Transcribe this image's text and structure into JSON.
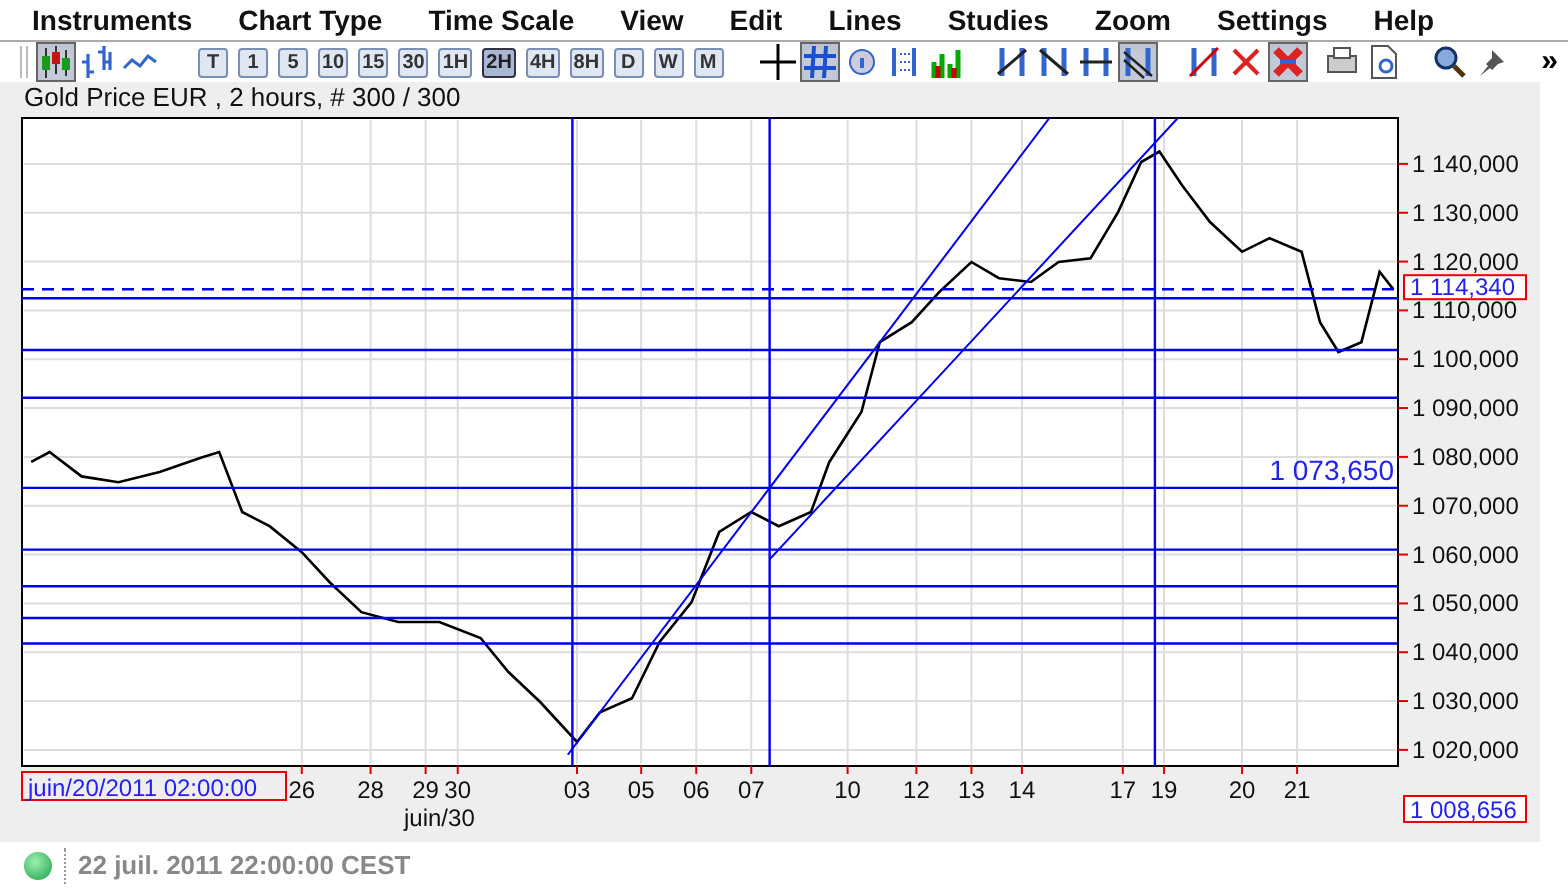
{
  "menu": [
    "Instruments",
    "Chart Type",
    "Time Scale",
    "View",
    "Edit",
    "Lines",
    "Studies",
    "Zoom",
    "Settings",
    "Help"
  ],
  "toolbar": {
    "chart_types": [
      {
        "kind": "candles",
        "selected": true
      },
      {
        "kind": "bars",
        "selected": false
      },
      {
        "kind": "line",
        "selected": false
      }
    ],
    "timeframes": [
      {
        "label": "T",
        "selected": false
      },
      {
        "label": "1",
        "selected": false
      },
      {
        "label": "5",
        "selected": false
      },
      {
        "label": "10",
        "selected": false
      },
      {
        "label": "15",
        "selected": false
      },
      {
        "label": "30",
        "selected": false
      },
      {
        "label": "1H",
        "selected": false
      },
      {
        "label": "2H",
        "selected": true
      },
      {
        "label": "4H",
        "selected": false
      },
      {
        "label": "8H",
        "selected": false
      },
      {
        "label": "D",
        "selected": false
      },
      {
        "label": "W",
        "selected": false
      },
      {
        "label": "M",
        "selected": false
      }
    ],
    "tools": [
      {
        "kind": "crosshair",
        "selected": false
      },
      {
        "kind": "grid",
        "selected": true
      },
      {
        "kind": "info",
        "selected": false
      },
      {
        "kind": "dots",
        "selected": false
      },
      {
        "kind": "volume",
        "selected": false
      },
      {
        "kind": "trend",
        "selected": false
      },
      {
        "kind": "fall",
        "selected": false
      },
      {
        "kind": "flat",
        "selected": false
      },
      {
        "kind": "channel",
        "selected": true
      },
      {
        "kind": "erase-line",
        "selected": false
      },
      {
        "kind": "delete",
        "selected": false
      },
      {
        "kind": "delete-all",
        "selected": true
      },
      {
        "kind": "print",
        "selected": false
      },
      {
        "kind": "preview",
        "selected": false
      },
      {
        "kind": "zoom",
        "selected": false
      },
      {
        "kind": "pin",
        "selected": false
      }
    ],
    "overflow": "»"
  },
  "chart_title": "Gold Price EUR , 2 hours, # 300 / 300",
  "chart": {
    "y_axis_labels": [
      "1 140,000",
      "1 130,000",
      "1 120,000",
      "1 110,000",
      "1 100,000",
      "1 090,000",
      "1 080,000",
      "1 070,000",
      "1 060,000",
      "1 050,000",
      "1 040,000",
      "1 030,000",
      "1 020,000"
    ],
    "x_axis_labels": [
      "26",
      "28",
      "29",
      "30",
      "03",
      "05",
      "06",
      "07",
      "10",
      "12",
      "13",
      "14",
      "17",
      "19",
      "20",
      "21"
    ],
    "line_label": "1 073,650",
    "cursor_time": "juin/20/2011 02:00:00",
    "month_label": "juin/30",
    "last_price": "1 114,340",
    "cursor_price": "1 008,656"
  },
  "status": {
    "connected": true,
    "time": "22 juil. 2011 22:00:00 CEST"
  }
}
